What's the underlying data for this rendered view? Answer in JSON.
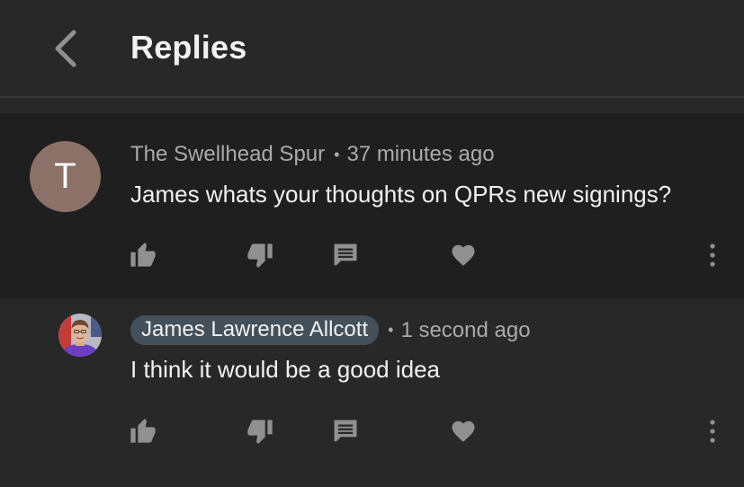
{
  "header": {
    "title": "Replies",
    "back_icon": "chevron-left-icon"
  },
  "colors": {
    "background": "#282828",
    "highlighted_comment_bg": "#1f1f1f",
    "avatar_bg": "#8c7168",
    "author_chip_bg": "#44505a",
    "secondary_text": "#aaaaaa",
    "primary_text": "#f1f1f1",
    "icon": "#909090"
  },
  "comments": [
    {
      "avatar_letter": "T",
      "author": "The Swellhead Spur",
      "separator": "•",
      "time": "37 minutes ago",
      "text": "James whats your thoughts on QPRs new signings?",
      "actions": [
        "like-icon",
        "dislike-icon",
        "reply-icon",
        "heart-icon",
        "more-vert-icon"
      ]
    },
    {
      "avatar_icon": "profile-photo",
      "author": "James Lawrence Allcott",
      "separator": "•",
      "time": "1 second ago",
      "text": "I think it would be a good idea",
      "actions": [
        "like-icon",
        "dislike-icon",
        "reply-icon",
        "heart-icon",
        "more-vert-icon"
      ]
    }
  ]
}
